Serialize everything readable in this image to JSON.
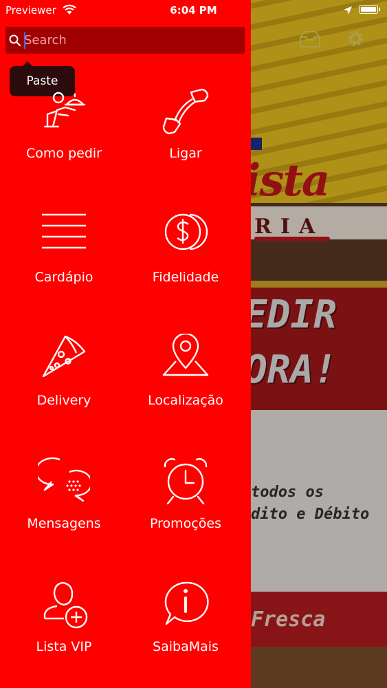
{
  "status_bar": {
    "carrier": "Previewer",
    "time": "6:04 PM"
  },
  "search": {
    "placeholder": "Search"
  },
  "context_menu": {
    "paste_label": "Paste"
  },
  "menu": {
    "items": [
      {
        "label": "Como pedir",
        "icon": "waiter-icon"
      },
      {
        "label": "Ligar",
        "icon": "phone-icon"
      },
      {
        "label": "Cardápio",
        "icon": "list-icon"
      },
      {
        "label": "Fidelidade",
        "icon": "coins-icon"
      },
      {
        "label": "Delivery",
        "icon": "pizza-slice-icon"
      },
      {
        "label": "Localização",
        "icon": "map-pin-icon"
      },
      {
        "label": "Mensagens",
        "icon": "chat-bubbles-icon"
      },
      {
        "label": "Promoções",
        "icon": "alarm-clock-icon"
      },
      {
        "label": "Lista VIP",
        "icon": "user-add-icon"
      },
      {
        "label": "SaibaMais",
        "icon": "info-bubble-icon"
      }
    ]
  },
  "background": {
    "logo_text": "ista",
    "banner_text": "RIA",
    "promo_line1": "EDIR",
    "promo_line2": "ORA!",
    "payment_line1": "todos os",
    "payment_line2": "dito e Débito",
    "footer_text": "Fresca"
  },
  "colors": {
    "menu_bg": "#ff0000",
    "search_bg": "#a10000",
    "tooltip_bg": "#2b0b0b"
  }
}
